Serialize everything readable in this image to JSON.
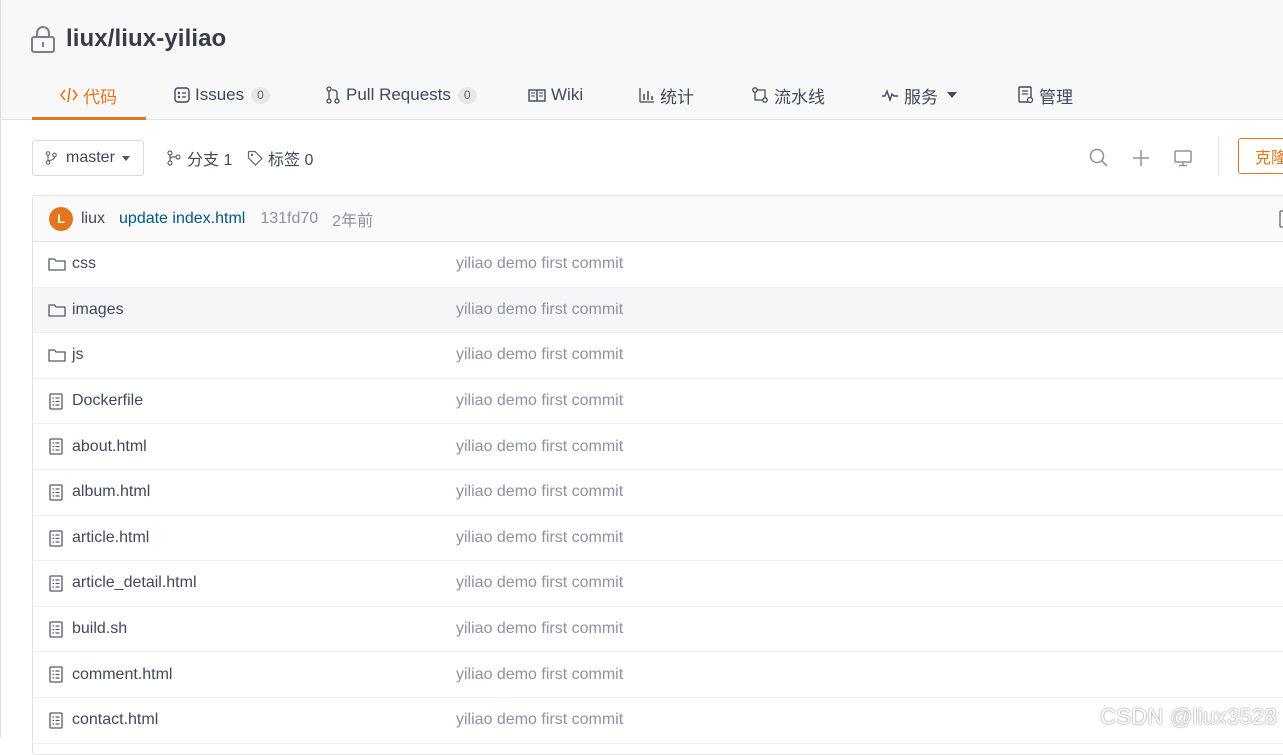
{
  "repo": {
    "title": "liux/liux-yiliao"
  },
  "tabs": [
    {
      "label": "代码",
      "icon": "code-icon",
      "active": true
    },
    {
      "label": "Issues",
      "count": "0",
      "icon": "issues-icon"
    },
    {
      "label": "Pull Requests",
      "count": "0",
      "icon": "pull-request-icon"
    },
    {
      "label": "Wiki",
      "icon": "wiki-book-icon"
    },
    {
      "label": "统计",
      "icon": "bar-chart-icon"
    },
    {
      "label": "流水线",
      "icon": "pipeline-icon"
    },
    {
      "label": "服务",
      "icon": "pulse-icon"
    },
    {
      "label": "管理",
      "icon": "settings-doc-icon"
    }
  ],
  "toolbar": {
    "branch": "master",
    "branches_label": "分支 1",
    "tags_label": "标签 0",
    "clone_label": "克隆/下载"
  },
  "commit": {
    "avatar_letter": "L",
    "author": "liux",
    "message": "update index.html",
    "sha": "131fd70",
    "time": "2年前"
  },
  "files": [
    {
      "name": "css",
      "type": "folder",
      "message": "yiliao demo first commit"
    },
    {
      "name": "images",
      "type": "folder",
      "message": "yiliao demo first commit"
    },
    {
      "name": "js",
      "type": "folder",
      "message": "yiliao demo first commit"
    },
    {
      "name": "Dockerfile",
      "type": "file",
      "message": "yiliao demo first commit"
    },
    {
      "name": "about.html",
      "type": "file",
      "message": "yiliao demo first commit"
    },
    {
      "name": "album.html",
      "type": "file",
      "message": "yiliao demo first commit"
    },
    {
      "name": "article.html",
      "type": "file",
      "message": "yiliao demo first commit"
    },
    {
      "name": "article_detail.html",
      "type": "file",
      "message": "yiliao demo first commit"
    },
    {
      "name": "build.sh",
      "type": "file",
      "message": "yiliao demo first commit"
    },
    {
      "name": "comment.html",
      "type": "file",
      "message": "yiliao demo first commit"
    },
    {
      "name": "contact.html",
      "type": "file",
      "message": "yiliao demo first commit"
    }
  ],
  "watermark": "CSDN @liux3528",
  "colors": {
    "accent": "#e2751e",
    "link": "#005980",
    "muted": "#8c92a4"
  }
}
